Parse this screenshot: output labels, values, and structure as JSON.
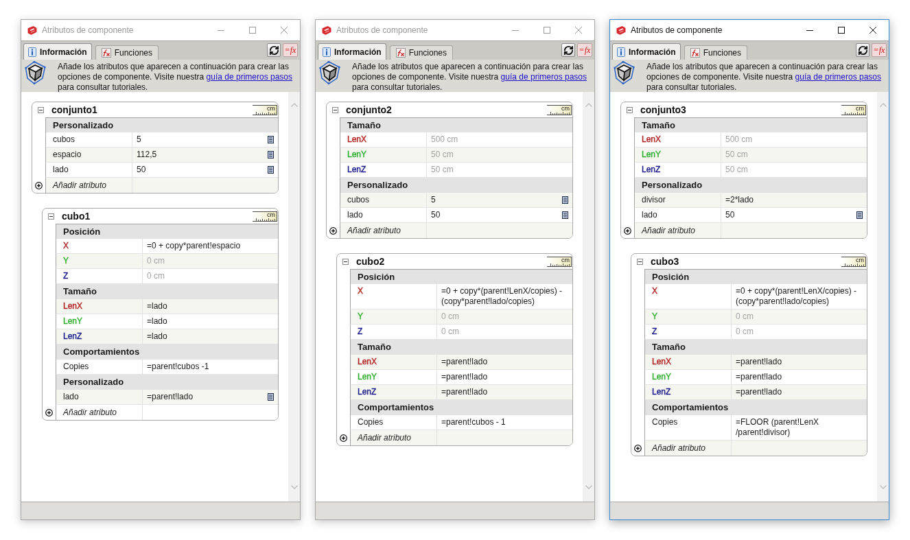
{
  "windows": [
    {
      "title": "Atributos de componente",
      "active": false,
      "tabs": [
        {
          "label": "Información",
          "kind": "info",
          "selected": true
        },
        {
          "label": "Funciones",
          "kind": "function",
          "selected": false
        }
      ],
      "tool_buttons": [
        {
          "kind": "refresh"
        },
        {
          "kind": "formula",
          "label": "=fx"
        }
      ],
      "info": {
        "text": "Añade los atributos que aparecen a continuación para crear las opciones de componente. Visite nuestra",
        "link": "guía de primeros pasos",
        "text_end": "para consultar tutoriales."
      },
      "components": [
        {
          "name": "conjunto1",
          "expanded": true,
          "units": "cm",
          "sections": [
            {
              "title": "Personalizado",
              "rows": [
                {
                  "name": "cubos",
                  "value": "5",
                  "disabled": false,
                  "details_button": true
                },
                {
                  "name": "espacio",
                  "value": "112,5",
                  "disabled": false,
                  "details_button": true
                },
                {
                  "name": "lado",
                  "value": "50",
                  "disabled": false,
                  "details_button": true
                }
              ]
            }
          ],
          "add_label": "Añadir atributo",
          "children": [
            {
              "name": "cubo1",
              "expanded": true,
              "units": "cm",
              "sections": [
                {
                  "title": "Posición",
                  "rows": [
                    {
                      "name": "X",
                      "color": "#b22222",
                      "value": "=0 + copy*parent!espacio",
                      "disabled": false,
                      "details_button": false
                    },
                    {
                      "name": "Y",
                      "color": "#2fae2f",
                      "value": "0 cm",
                      "disabled": true,
                      "details_button": false
                    },
                    {
                      "name": "Z",
                      "color": "#1c1c8c",
                      "value": "0 cm",
                      "disabled": true,
                      "details_button": false
                    }
                  ]
                },
                {
                  "title": "Tamaño",
                  "rows": [
                    {
                      "name": "LenX",
                      "color": "#b22222",
                      "value": "=lado",
                      "disabled": false,
                      "details_button": false
                    },
                    {
                      "name": "LenY",
                      "color": "#2fae2f",
                      "value": "=lado",
                      "disabled": false,
                      "details_button": false
                    },
                    {
                      "name": "LenZ",
                      "color": "#1c1c8c",
                      "value": "=lado",
                      "disabled": false,
                      "details_button": false
                    }
                  ]
                },
                {
                  "title": "Comportamientos",
                  "rows": [
                    {
                      "name": "Copies",
                      "value": "=parent!cubos -1",
                      "disabled": false,
                      "details_button": false
                    }
                  ]
                },
                {
                  "title": "Personalizado",
                  "rows": [
                    {
                      "name": "lado",
                      "value": "=parent!lado",
                      "disabled": false,
                      "details_button": true
                    }
                  ]
                }
              ],
              "add_label": "Añadir atributo"
            }
          ]
        }
      ]
    },
    {
      "title": "Atributos de componente",
      "active": false,
      "tabs": [
        {
          "label": "Información",
          "kind": "info",
          "selected": true
        },
        {
          "label": "Funciones",
          "kind": "function",
          "selected": false
        }
      ],
      "tool_buttons": [
        {
          "kind": "refresh"
        },
        {
          "kind": "formula",
          "label": "=fx"
        }
      ],
      "info": {
        "text": "Añade los atributos que aparecen a continuación para crear las opciones de componente. Visite nuestra",
        "link": "guía de primeros pasos",
        "text_end": "para consultar tutoriales."
      },
      "components": [
        {
          "name": "conjunto2",
          "expanded": true,
          "units": "cm",
          "sections": [
            {
              "title": "Tamaño",
              "rows": [
                {
                  "name": "LenX",
                  "color": "#b22222",
                  "value": "500 cm",
                  "disabled": true,
                  "details_button": false
                },
                {
                  "name": "LenY",
                  "color": "#2fae2f",
                  "value": "50 cm",
                  "disabled": true,
                  "details_button": false
                },
                {
                  "name": "LenZ",
                  "color": "#1c1c8c",
                  "value": "50 cm",
                  "disabled": true,
                  "details_button": false
                }
              ]
            },
            {
              "title": "Personalizado",
              "rows": [
                {
                  "name": "cubos",
                  "value": "5",
                  "disabled": false,
                  "details_button": true
                },
                {
                  "name": "lado",
                  "value": "50",
                  "disabled": false,
                  "details_button": true
                }
              ]
            }
          ],
          "add_label": "Añadir atributo",
          "children": [
            {
              "name": "cubo2",
              "expanded": true,
              "units": "cm",
              "sections": [
                {
                  "title": "Posición",
                  "rows": [
                    {
                      "name": "X",
                      "color": "#b22222",
                      "value": "=0 + copy*(parent!LenX/copies) - (copy*parent!lado/copies)",
                      "disabled": false,
                      "details_button": false
                    },
                    {
                      "name": "Y",
                      "color": "#2fae2f",
                      "value": "0 cm",
                      "disabled": true,
                      "details_button": false
                    },
                    {
                      "name": "Z",
                      "color": "#1c1c8c",
                      "value": "0 cm",
                      "disabled": true,
                      "details_button": false
                    }
                  ]
                },
                {
                  "title": "Tamaño",
                  "rows": [
                    {
                      "name": "LenX",
                      "color": "#b22222",
                      "value": "=parent!lado",
                      "disabled": false,
                      "details_button": false
                    },
                    {
                      "name": "LenY",
                      "color": "#2fae2f",
                      "value": "=parent!lado",
                      "disabled": false,
                      "details_button": false
                    },
                    {
                      "name": "LenZ",
                      "color": "#1c1c8c",
                      "value": "=parent!lado",
                      "disabled": false,
                      "details_button": false
                    }
                  ]
                },
                {
                  "title": "Comportamientos",
                  "rows": [
                    {
                      "name": "Copies",
                      "value": "=parent!cubos - 1",
                      "disabled": false,
                      "details_button": false
                    }
                  ]
                }
              ],
              "add_label": "Añadir atributo"
            }
          ]
        }
      ]
    },
    {
      "title": "Atributos de componente",
      "active": true,
      "tabs": [
        {
          "label": "Información",
          "kind": "info",
          "selected": true
        },
        {
          "label": "Funciones",
          "kind": "function",
          "selected": false
        }
      ],
      "tool_buttons": [
        {
          "kind": "refresh"
        },
        {
          "kind": "formula",
          "label": "=fx"
        }
      ],
      "info": {
        "text": "Añade los atributos que aparecen a continuación para crear las opciones de componente. Visite nuestra",
        "link": "guía de primeros pasos",
        "text_end": "para consultar tutoriales."
      },
      "components": [
        {
          "name": "conjunto3",
          "expanded": true,
          "units": "cm",
          "sections": [
            {
              "title": "Tamaño",
              "rows": [
                {
                  "name": "LenX",
                  "color": "#b22222",
                  "value": "500 cm",
                  "disabled": true,
                  "details_button": false
                },
                {
                  "name": "LenY",
                  "color": "#2fae2f",
                  "value": "50 cm",
                  "disabled": true,
                  "details_button": false
                },
                {
                  "name": "LenZ",
                  "color": "#1c1c8c",
                  "value": "50 cm",
                  "disabled": true,
                  "details_button": false
                }
              ]
            },
            {
              "title": "Personalizado",
              "rows": [
                {
                  "name": "divisor",
                  "value": "=2*lado",
                  "disabled": false,
                  "details_button": false
                },
                {
                  "name": "lado",
                  "value": "50",
                  "disabled": false,
                  "details_button": true
                }
              ]
            }
          ],
          "add_label": "Añadir atributo",
          "children": [
            {
              "name": "cubo3",
              "expanded": true,
              "units": "cm",
              "sections": [
                {
                  "title": "Posición",
                  "rows": [
                    {
                      "name": "X",
                      "color": "#b22222",
                      "value": "=0 + copy*(parent!LenX/copies) - (copy*parent!lado/copies)",
                      "disabled": false,
                      "details_button": false
                    },
                    {
                      "name": "Y",
                      "color": "#2fae2f",
                      "value": "0 cm",
                      "disabled": true,
                      "details_button": false
                    },
                    {
                      "name": "Z",
                      "color": "#1c1c8c",
                      "value": "0 cm",
                      "disabled": true,
                      "details_button": false
                    }
                  ]
                },
                {
                  "title": "Tamaño",
                  "rows": [
                    {
                      "name": "LenX",
                      "color": "#b22222",
                      "value": "=parent!lado",
                      "disabled": false,
                      "details_button": false
                    },
                    {
                      "name": "LenY",
                      "color": "#2fae2f",
                      "value": "=parent!lado",
                      "disabled": false,
                      "details_button": false
                    },
                    {
                      "name": "LenZ",
                      "color": "#1c1c8c",
                      "value": "=parent!lado",
                      "disabled": false,
                      "details_button": false
                    }
                  ]
                },
                {
                  "title": "Comportamientos",
                  "rows": [
                    {
                      "name": "Copies",
                      "value": "=FLOOR (parent!LenX /parent!divisor)",
                      "disabled": false,
                      "details_button": false
                    }
                  ]
                }
              ],
              "add_label": "Añadir atributo"
            }
          ]
        }
      ]
    }
  ]
}
